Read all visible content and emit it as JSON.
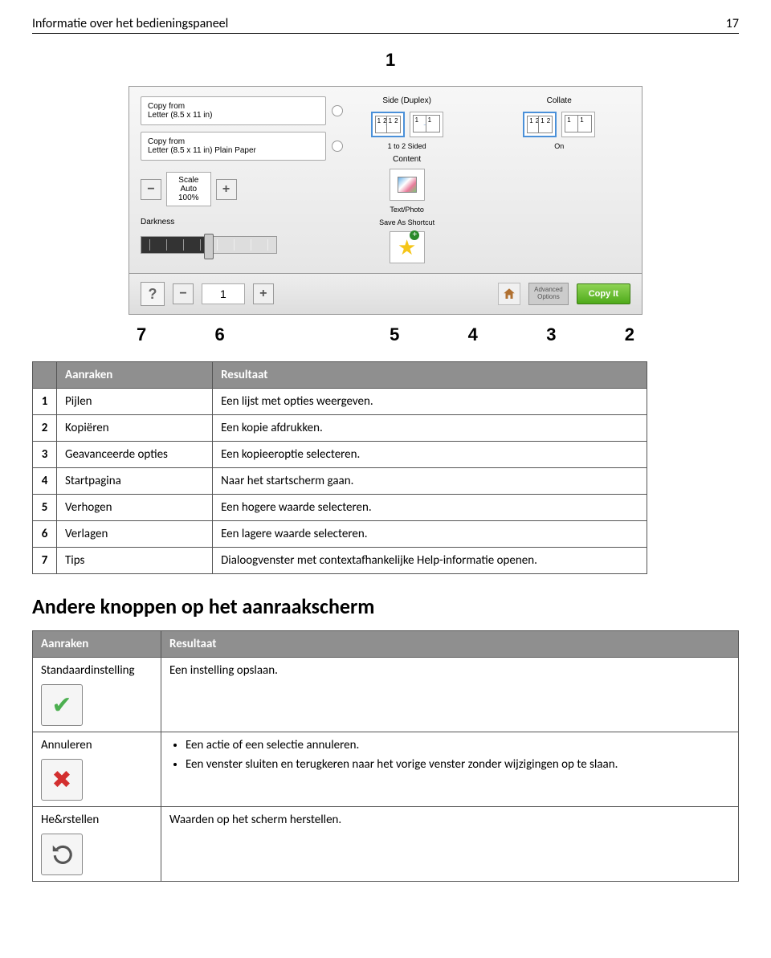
{
  "header": {
    "title": "Informatie over het bedieningspaneel",
    "page": "17"
  },
  "callouts": {
    "top": "1",
    "bottom": [
      "7",
      "6",
      "5",
      "4",
      "3",
      "2"
    ]
  },
  "panel": {
    "copy_from": "Copy from",
    "paper1": "Letter (8.5 x 11 in)",
    "paper2": "Letter (8.5 x 11 in) Plain Paper",
    "scale_label": "Scale",
    "scale_auto": "Auto",
    "scale_pct": "100%",
    "darkness": "Darkness",
    "side_duplex": "Side (Duplex)",
    "sided_label": "1 to 2 Sided",
    "content": "Content",
    "text_photo": "Text/Photo",
    "save_shortcut": "Save As Shortcut",
    "collate": "Collate",
    "collate_on": "On",
    "count": "1",
    "adv_options": "Advanced\nOptions",
    "copy_it": "Copy It"
  },
  "table1": {
    "hdr_touch": "Aanraken",
    "hdr_result": "Resultaat",
    "rows": [
      {
        "n": "1",
        "a": "Pijlen",
        "b": "Een lijst met opties weergeven."
      },
      {
        "n": "2",
        "a": "Kopiëren",
        "b": "Een kopie afdrukken."
      },
      {
        "n": "3",
        "a": "Geavanceerde opties",
        "b": "Een kopieeroptie selecteren."
      },
      {
        "n": "4",
        "a": "Startpagina",
        "b": "Naar het startscherm gaan."
      },
      {
        "n": "5",
        "a": "Verhogen",
        "b": "Een hogere waarde selecteren."
      },
      {
        "n": "6",
        "a": "Verlagen",
        "b": "Een lagere waarde selecteren."
      },
      {
        "n": "7",
        "a": "Tips",
        "b": "Dialoogvenster met contextafhankelijke Help-informatie openen."
      }
    ]
  },
  "section2": {
    "heading": "Andere knoppen op het aanraakscherm",
    "hdr_touch": "Aanraken",
    "hdr_result": "Resultaat",
    "rows": [
      {
        "label": "Standaardinstelling",
        "desc": "Een instelling opslaan."
      },
      {
        "label": "Annuleren",
        "bullets": [
          "Een actie of een selectie annuleren.",
          "Een venster sluiten en terugkeren naar het vorige venster zonder wijzigingen op te slaan."
        ]
      },
      {
        "label": "He&rstellen",
        "desc": "Waarden op het scherm herstellen."
      }
    ]
  }
}
